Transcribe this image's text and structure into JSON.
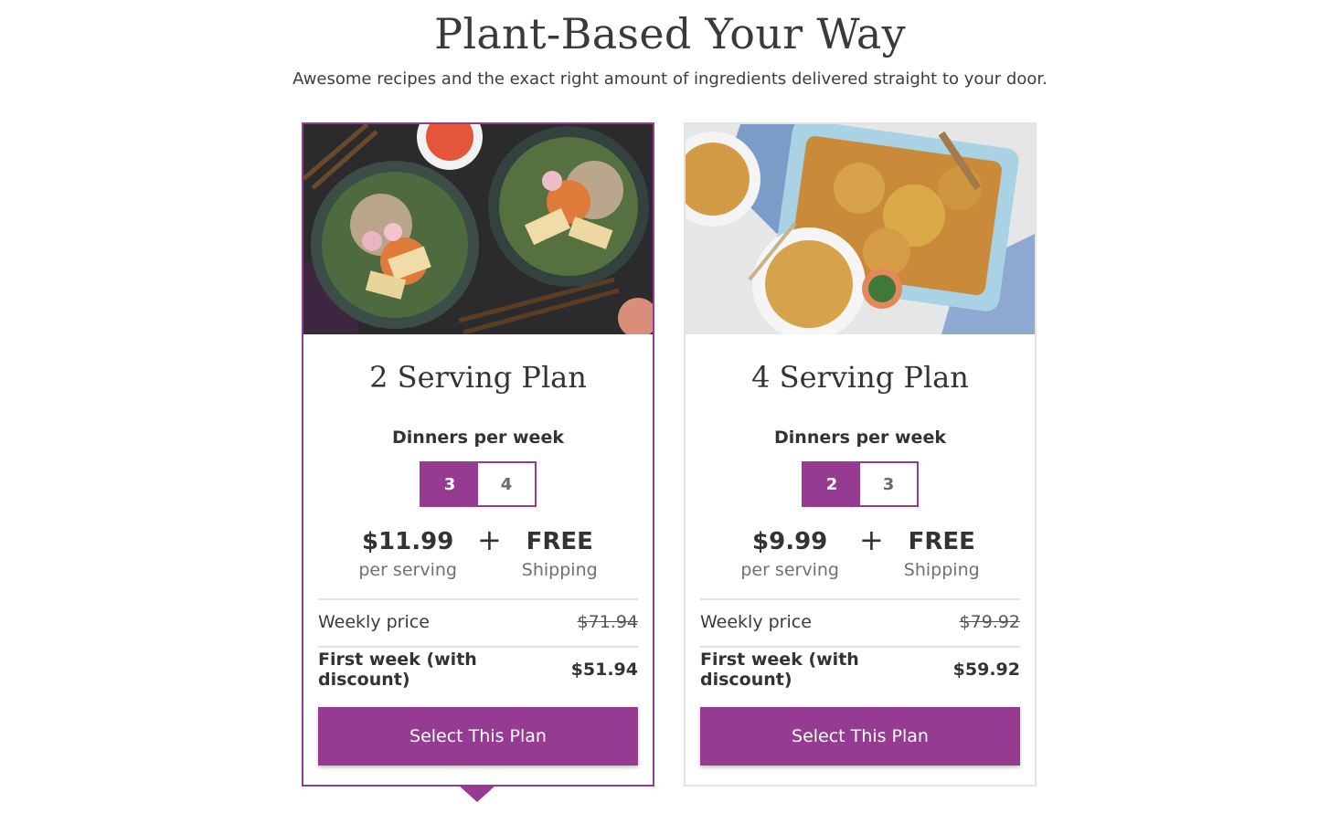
{
  "header": {
    "title": "Plant-Based Your Way",
    "subtitle": "Awesome recipes and the exact right amount of ingredients delivered straight to your door."
  },
  "colors": {
    "accent": "#963b92",
    "text": "#333333",
    "muted": "#707070",
    "divider": "#e2e2e2"
  },
  "plans": [
    {
      "title": "2 Serving Plan",
      "image": "tofu-rice-bowls-photo",
      "dinners_label": "Dinners per week",
      "options": [
        "3",
        "4"
      ],
      "selected_option": "3",
      "price": "$11.99",
      "price_sub": "per serving",
      "plus": "+",
      "shipping": "FREE",
      "shipping_sub": "Shipping",
      "weekly_label": "Weekly price",
      "weekly_price": "$71.94",
      "first_week_label": "First week (with discount)",
      "first_week_price": "$51.94",
      "button_label": "Select This Plan",
      "selected": true
    },
    {
      "title": "4 Serving Plan",
      "image": "baked-mac-casserole-photo",
      "dinners_label": "Dinners per week",
      "options": [
        "2",
        "3"
      ],
      "selected_option": "2",
      "price": "$9.99",
      "price_sub": "per serving",
      "plus": "+",
      "shipping": "FREE",
      "shipping_sub": "Shipping",
      "weekly_label": "Weekly price",
      "weekly_price": "$79.92",
      "first_week_label": "First week (with discount)",
      "first_week_price": "$59.92",
      "button_label": "Select This Plan",
      "selected": false
    }
  ]
}
